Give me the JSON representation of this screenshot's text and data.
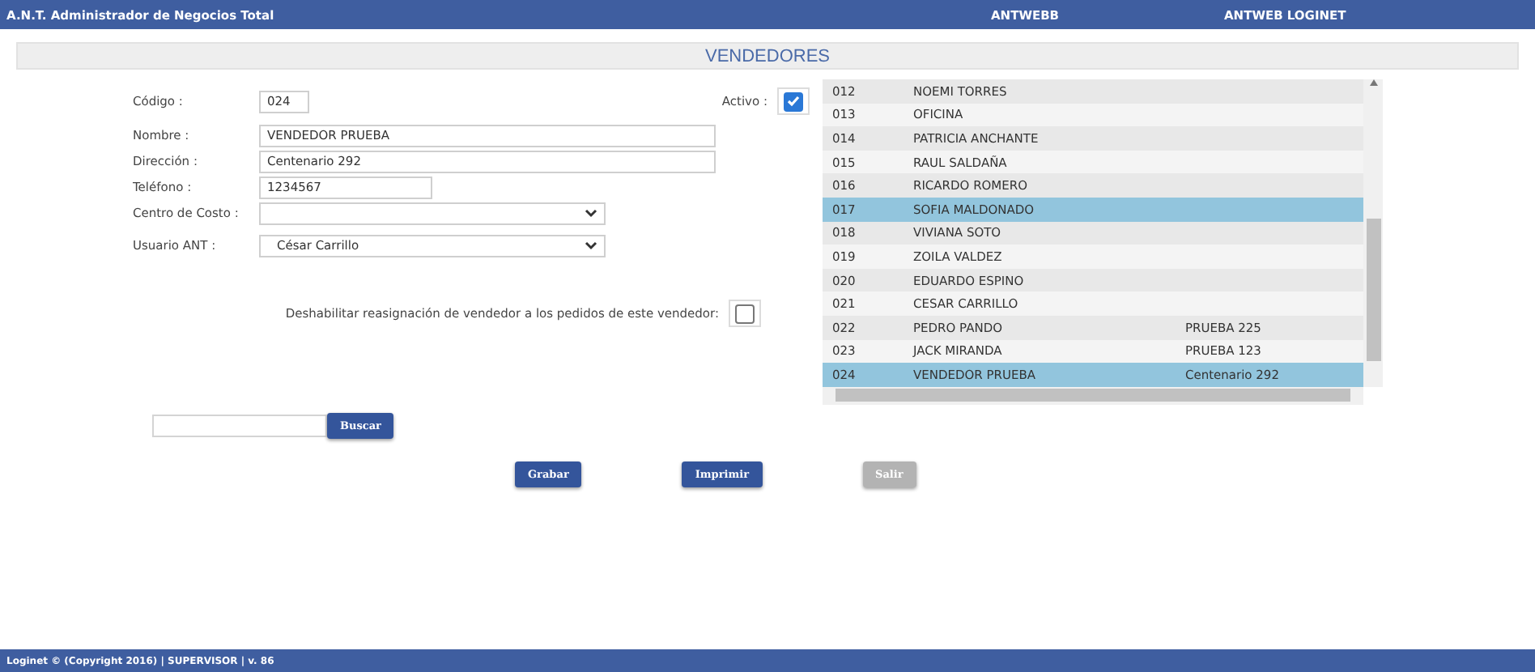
{
  "header": {
    "app_title": "A.N.T. Administrador de Negocios Total",
    "links": [
      "ANTWEBB",
      "ANTWEB LOGINET"
    ]
  },
  "page_title": "VENDEDORES",
  "form": {
    "codigo": {
      "label": "Código :",
      "value": "024"
    },
    "activo": {
      "label": "Activo :",
      "checked": true
    },
    "fields": [
      {
        "label": "Nombre :",
        "value": "VENDEDOR PRUEBA",
        "kind": "text"
      },
      {
        "label": "Dirección :",
        "value": "Centenario 292",
        "kind": "text"
      },
      {
        "label": "Teléfono :",
        "value": "1234567",
        "kind": "text"
      },
      {
        "label": "Centro de Costo :",
        "kind": "select"
      },
      {
        "label": "Usuario ANT :",
        "value": "César Carrillo",
        "kind": "select"
      }
    ],
    "deshabilitar": {
      "label": "Deshabilitar reasignación de vendedor a los pedidos de este vendedor:",
      "checked": false
    }
  },
  "list": {
    "rows": [
      {
        "code": "012",
        "name": "NOEMI TORRES",
        "selected": false
      },
      {
        "code": "013",
        "name": "OFICINA",
        "selected": false
      },
      {
        "code": "014",
        "name": "PATRICIA ANCHANTE",
        "selected": false
      },
      {
        "code": "015",
        "name": "RAUL SALDAÑA",
        "selected": false
      },
      {
        "code": "016",
        "name": "RICARDO ROMERO",
        "selected": false
      },
      {
        "code": "017",
        "name": "SOFIA MALDONADO",
        "selected": true
      },
      {
        "code": "018",
        "name": "VIVIANA SOTO",
        "selected": false
      },
      {
        "code": "019",
        "name": "ZOILA VALDEZ",
        "selected": false
      },
      {
        "code": "020",
        "name": "EDUARDO ESPINO",
        "selected": false
      },
      {
        "code": "021",
        "name": "CESAR CARRILLO",
        "selected": false
      },
      {
        "code": "022",
        "name": "PEDRO PANDO",
        "address": "PRUEBA 225",
        "selected": false
      },
      {
        "code": "023",
        "name": "JACK MIRANDA",
        "address": "PRUEBA 123",
        "selected": false
      },
      {
        "code": "024",
        "name": "VENDEDOR PRUEBA",
        "address": "Centenario 292",
        "selected": true
      }
    ]
  },
  "search": {
    "button": "Buscar"
  },
  "buttons": [
    {
      "label": "Grabar",
      "disabled": false
    },
    {
      "label": "Imprimir",
      "disabled": false
    },
    {
      "label": "Salir",
      "disabled": true
    }
  ],
  "footer": "Loginet © (Copyright 2016) | SUPERVISOR | v. 86"
}
